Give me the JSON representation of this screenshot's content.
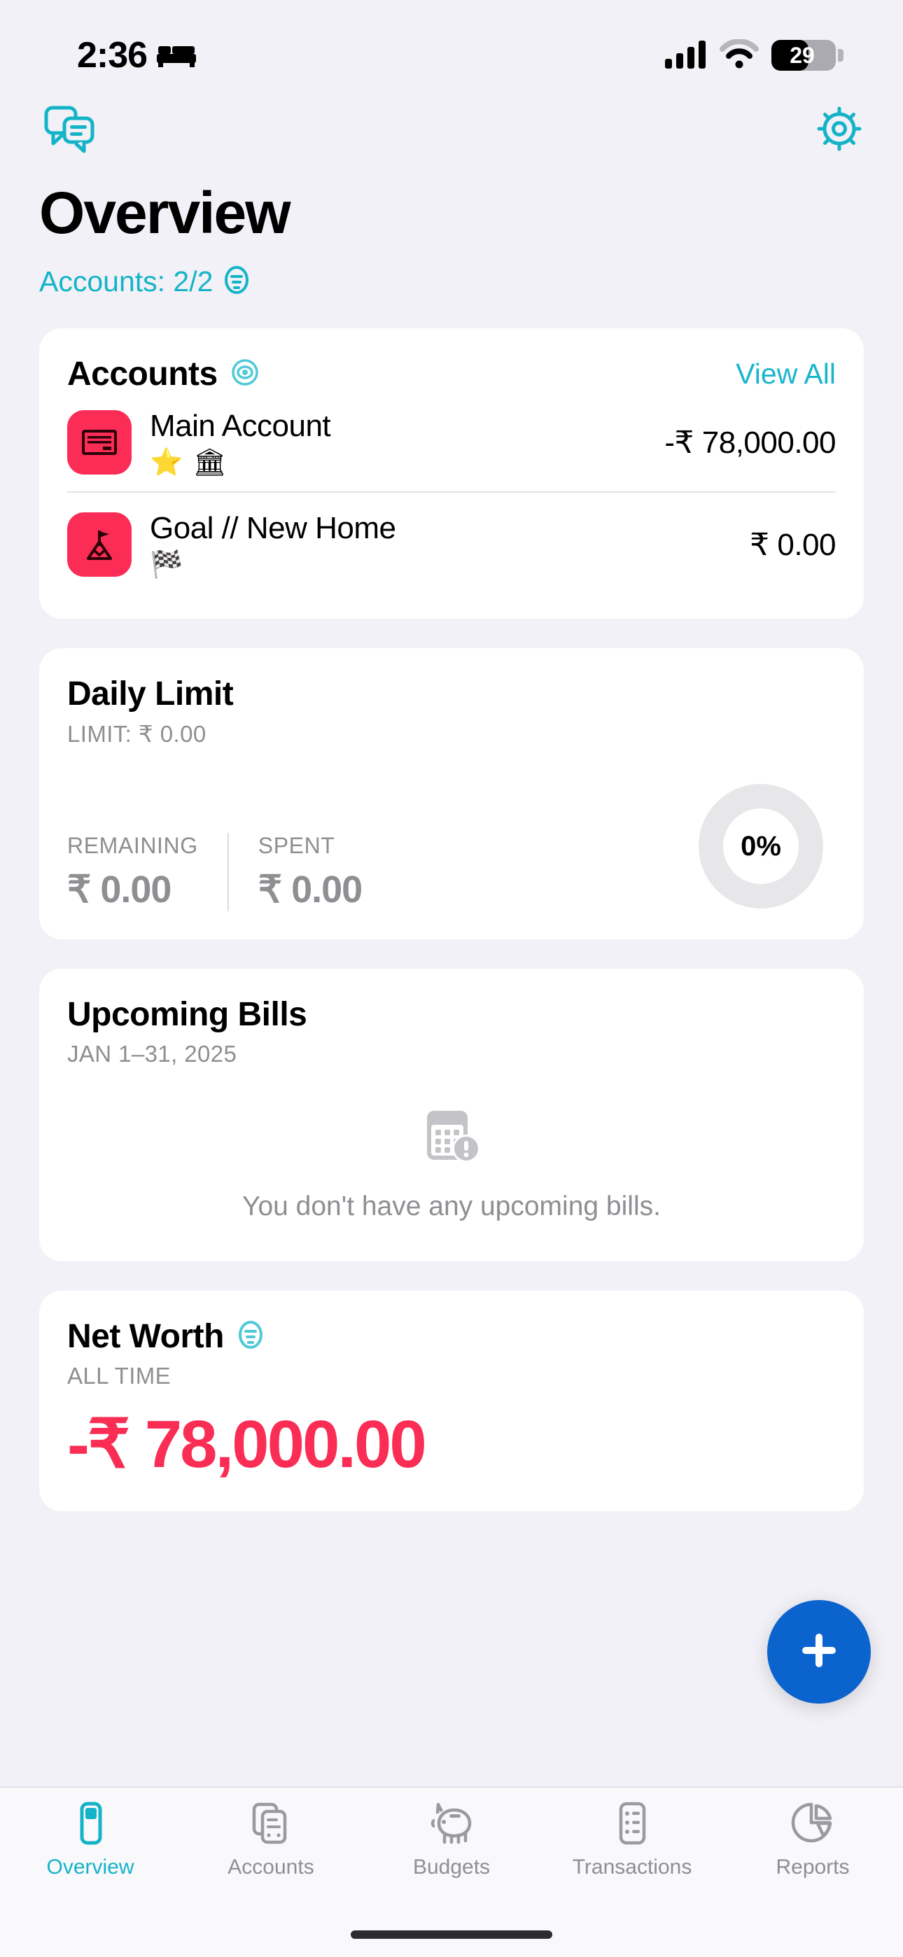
{
  "status_bar": {
    "time": "2:36",
    "sleep_icon": "bed-icon",
    "cellular_icon": "cellular-bars-icon",
    "wifi_icon": "wifi-icon",
    "battery_percent": "29",
    "battery_icon": "battery-low-icon"
  },
  "nav": {
    "messages_icon": "chat-bubbles-icon",
    "settings_icon": "gear-icon"
  },
  "header": {
    "title": "Overview",
    "accounts_filter_label": "Accounts: 2/2",
    "accounts_filter_icon": "filter-list-circle-icon",
    "accent_color": "#14b3c8"
  },
  "accounts_card": {
    "title": "Accounts",
    "visibility_icon": "eye-icon",
    "view_all_label": "View All",
    "rows": [
      {
        "name": "Main Account",
        "amount": "-₹ 78,000.00",
        "icon": "card-icon",
        "icon_color": "#fb2c55",
        "badges": [
          "star-emoji",
          "bank-emoji"
        ],
        "badge_glyphs": [
          "⭐",
          "🏛"
        ]
      },
      {
        "name": "Goal // New Home",
        "amount": "₹ 0.00",
        "icon": "mountain-flag-icon",
        "icon_color": "#fb2c55",
        "badges": [
          "checkered-flag-emoji"
        ],
        "badge_glyphs": [
          "🏁"
        ]
      }
    ]
  },
  "daily_limit_card": {
    "title": "Daily Limit",
    "subtitle": "LIMIT: ₹ 0.00",
    "remaining_label": "REMAINING",
    "remaining_value": "₹ 0.00",
    "spent_label": "SPENT",
    "spent_value": "₹ 0.00",
    "percent_label": "0%",
    "percent_value": 0,
    "ring_color": "#e7e7ea"
  },
  "upcoming_bills_card": {
    "title": "Upcoming Bills",
    "subtitle": "JAN 1–31, 2025",
    "empty_icon": "calendar-exclamation-icon",
    "empty_text": "You don't have any upcoming bills."
  },
  "net_worth_card": {
    "title": "Net Worth",
    "filter_icon": "filter-list-circle-icon",
    "subtitle": "ALL TIME",
    "amount": "-₹ 78,000.00",
    "amount_color": "#fa2d55"
  },
  "fab": {
    "label": "add-transaction",
    "icon": "plus-icon",
    "color": "#0b63ce"
  },
  "tab_bar": {
    "active_index": 0,
    "items": [
      {
        "label": "Overview",
        "icon": "overview-icon"
      },
      {
        "label": "Accounts",
        "icon": "accounts-cards-icon"
      },
      {
        "label": "Budgets",
        "icon": "piggy-bank-icon"
      },
      {
        "label": "Transactions",
        "icon": "list-icon"
      },
      {
        "label": "Reports",
        "icon": "pie-chart-icon"
      }
    ]
  }
}
